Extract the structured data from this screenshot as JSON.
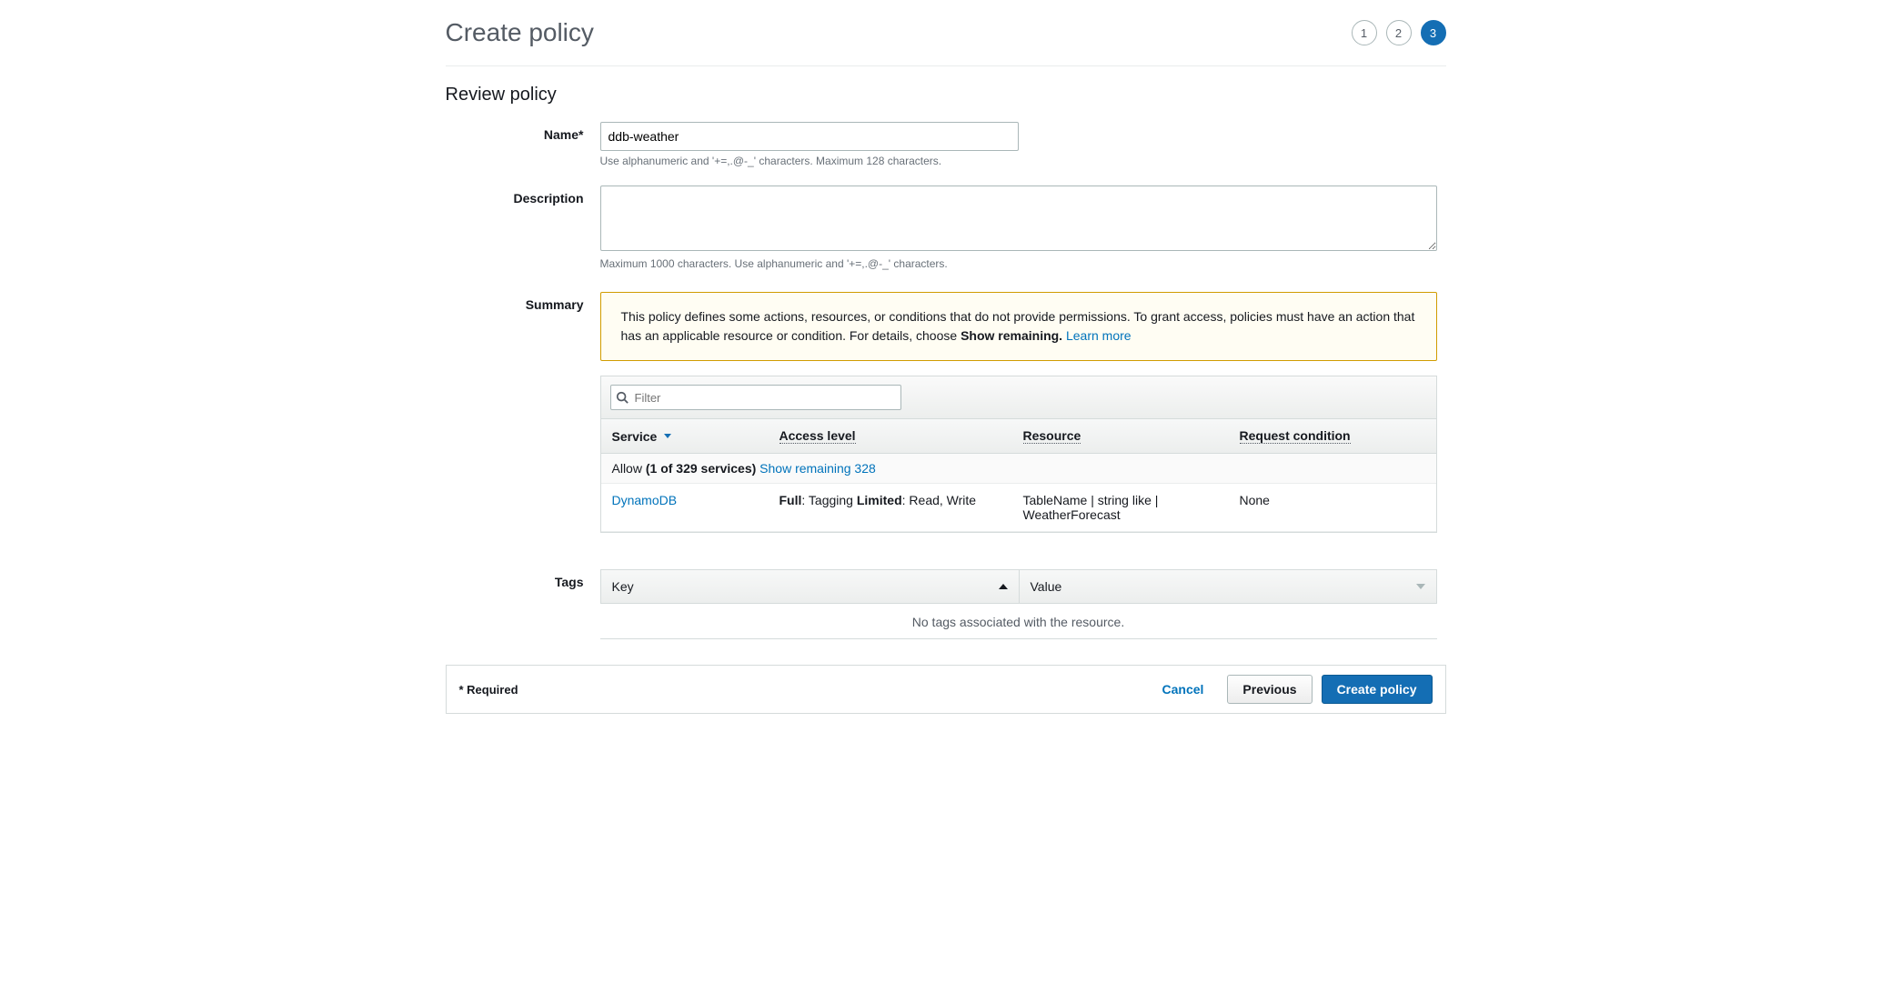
{
  "header": {
    "title": "Create policy",
    "steps": [
      "1",
      "2",
      "3"
    ],
    "activeStep": "3"
  },
  "section_title": "Review policy",
  "form": {
    "name_label": "Name*",
    "name_value": "ddb-weather",
    "name_hint": "Use alphanumeric and '+=,.@-_' characters. Maximum 128 characters.",
    "description_label": "Description",
    "description_value": "",
    "description_hint": "Maximum 1000 characters. Use alphanumeric and '+=,.@-_' characters.",
    "summary_label": "Summary"
  },
  "warning": {
    "text_before": "This policy defines some actions, resources, or conditions that do not provide permissions. To grant access, policies must have an action that has an applicable resource or condition. For details, choose ",
    "bold": "Show remaining.",
    "learn_more": "Learn more"
  },
  "filter": {
    "placeholder": "Filter"
  },
  "columns": {
    "service": "Service",
    "access": "Access level",
    "resource": "Resource",
    "request": "Request condition"
  },
  "allow": {
    "prefix": "Allow ",
    "bold": "(1 of 329 services)",
    "remaining": "Show remaining 328"
  },
  "row": {
    "service": "DynamoDB",
    "access_full": "Full",
    "access_full_detail": ": Tagging ",
    "access_limited": "Limited",
    "access_limited_detail": ": Read, Write",
    "resource": "TableName | string like | WeatherForecast",
    "request": "None"
  },
  "tags": {
    "label": "Tags",
    "key": "Key",
    "value": "Value",
    "empty": "No tags associated with the resource."
  },
  "footer": {
    "required": "* Required",
    "cancel": "Cancel",
    "previous": "Previous",
    "create": "Create policy"
  }
}
